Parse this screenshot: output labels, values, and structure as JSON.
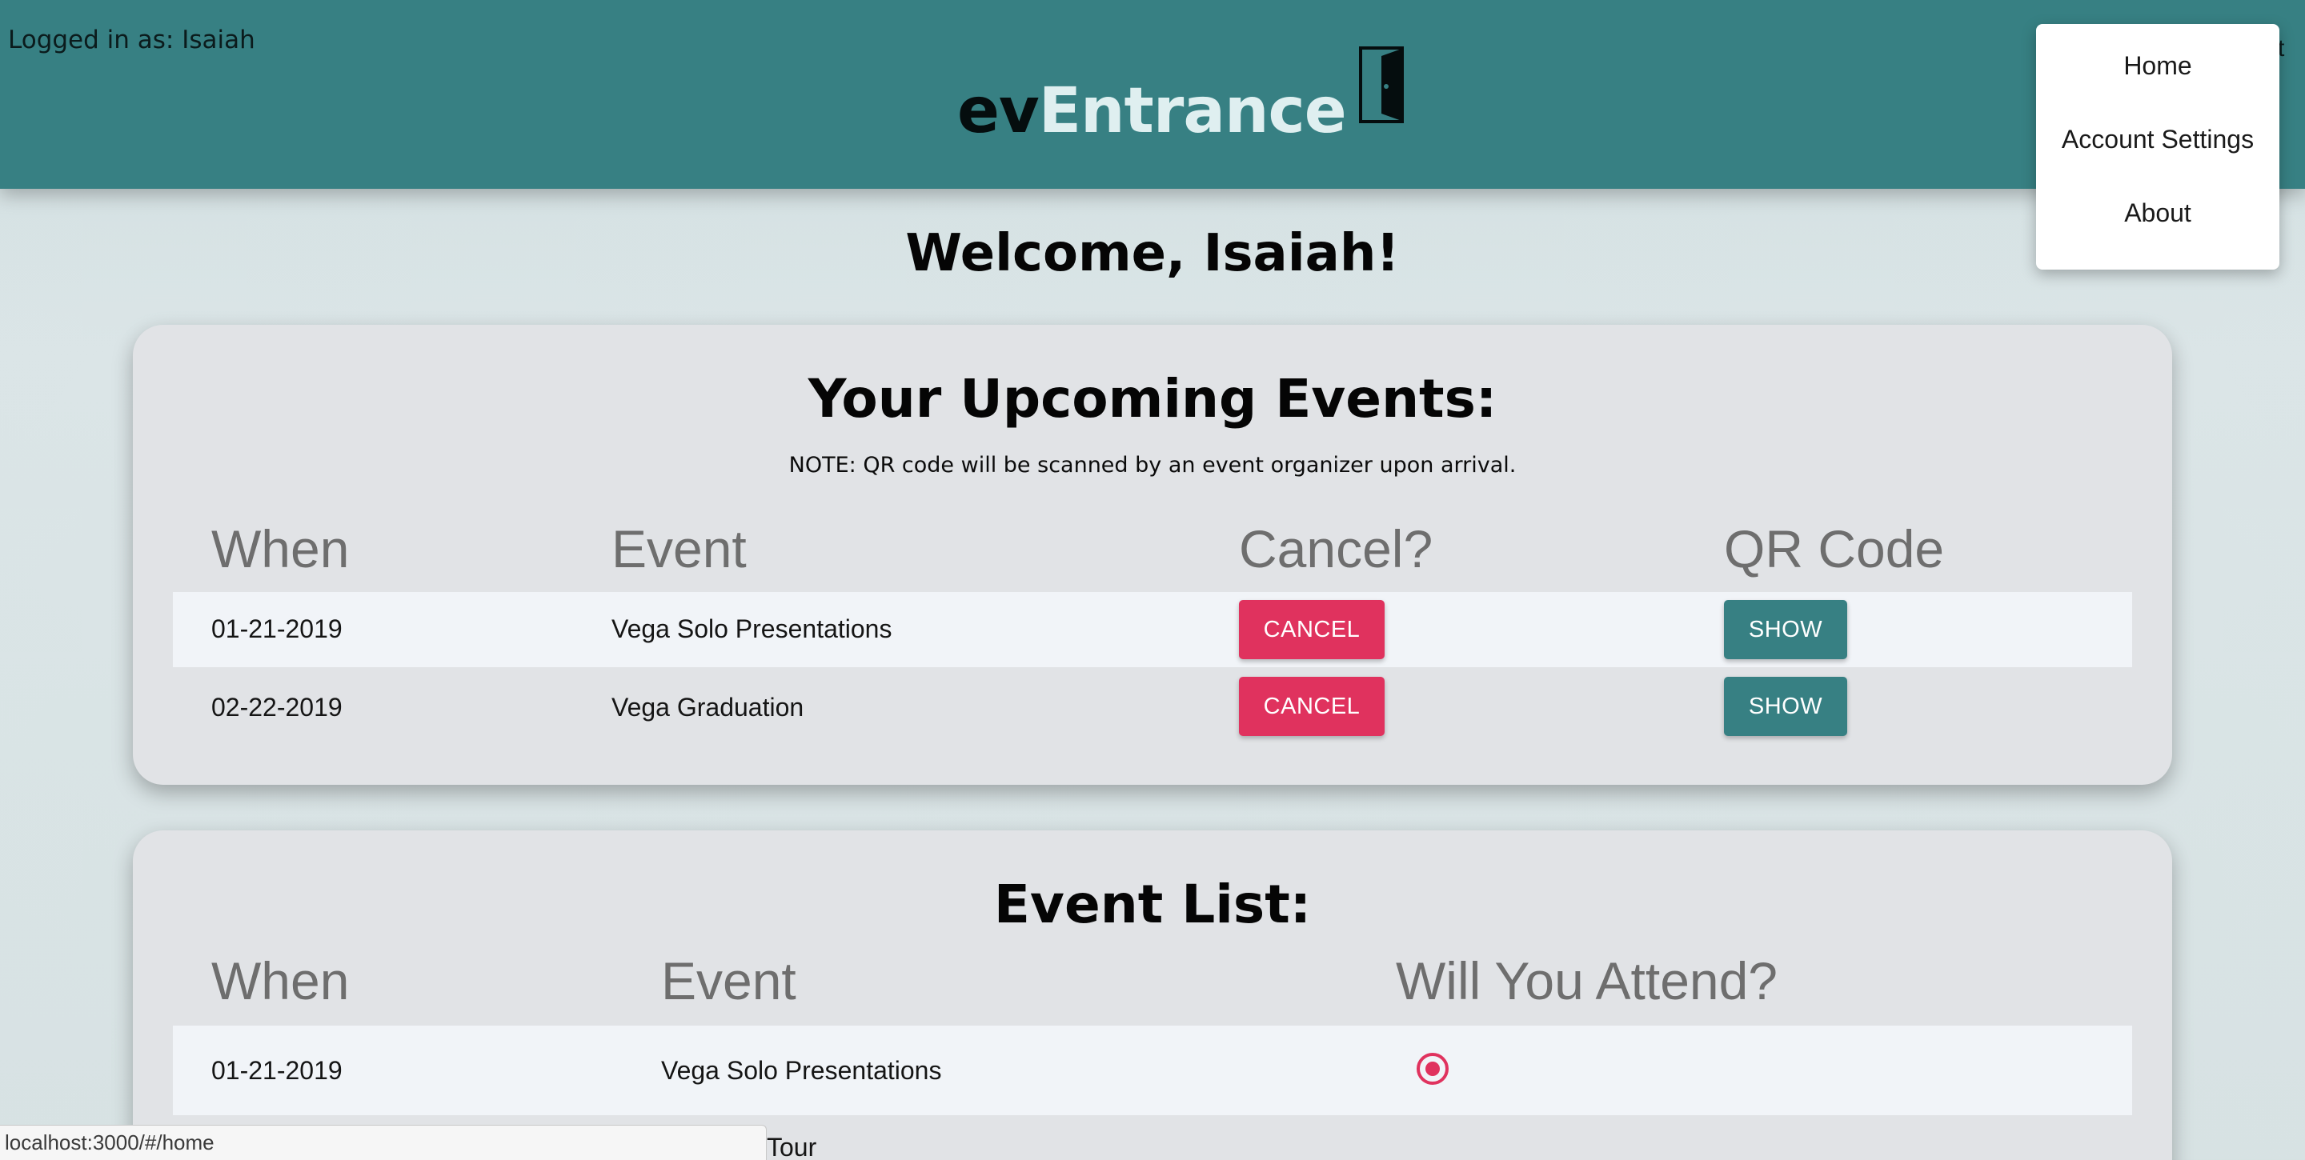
{
  "header": {
    "logged_in": "Logged in as: Isaiah",
    "logo_part1": "ev",
    "logo_part2": "Entrance",
    "cut_text": "t",
    "bg_color": "#378083"
  },
  "dropdown": {
    "items": [
      {
        "label": "Home"
      },
      {
        "label": "Account Settings"
      },
      {
        "label": "About"
      }
    ]
  },
  "welcome": "Welcome, Isaiah!",
  "upcoming": {
    "title": "Your Upcoming Events:",
    "note": "NOTE: QR code will be scanned by an event organizer upon arrival.",
    "columns": [
      "When",
      "Event",
      "Cancel?",
      "QR Code"
    ],
    "rows": [
      {
        "when": "01-21-2019",
        "event": "Vega Solo Presentations",
        "cancel_label": "CANCEL",
        "qr_label": "SHOW"
      },
      {
        "when": "02-22-2019",
        "event": "Vega Graduation",
        "cancel_label": "CANCEL",
        "qr_label": "SHOW"
      }
    ]
  },
  "event_list": {
    "title": "Event List:",
    "columns": [
      "When",
      "Event",
      "Will You Attend?"
    ],
    "rows": [
      {
        "when": "01-21-2019",
        "event": "Vega Solo Presentations",
        "attending": true
      },
      {
        "when": "",
        "event": "Tour",
        "attending": false
      }
    ]
  },
  "colors": {
    "accent": "#e0325e",
    "teal": "#378083"
  },
  "status_bar": {
    "url": "localhost:3000/#/home"
  }
}
